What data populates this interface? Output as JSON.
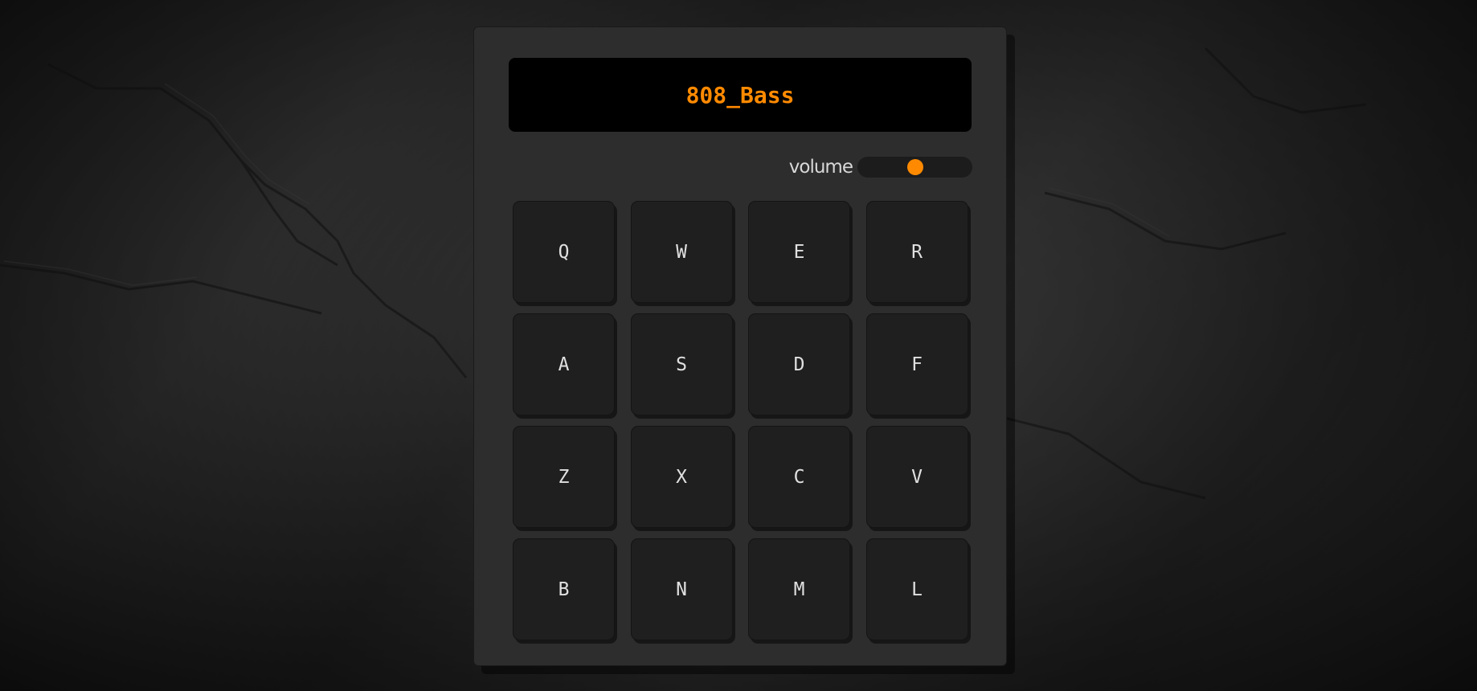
{
  "display": {
    "text": "808_Bass",
    "color": "#ff8a00"
  },
  "volume": {
    "label": "volume",
    "value": 0.5
  },
  "pads": [
    {
      "key": "Q"
    },
    {
      "key": "W"
    },
    {
      "key": "E"
    },
    {
      "key": "R"
    },
    {
      "key": "A"
    },
    {
      "key": "S"
    },
    {
      "key": "D"
    },
    {
      "key": "F"
    },
    {
      "key": "Z"
    },
    {
      "key": "X"
    },
    {
      "key": "C"
    },
    {
      "key": "V"
    },
    {
      "key": "B"
    },
    {
      "key": "N"
    },
    {
      "key": "M"
    },
    {
      "key": "L"
    }
  ]
}
